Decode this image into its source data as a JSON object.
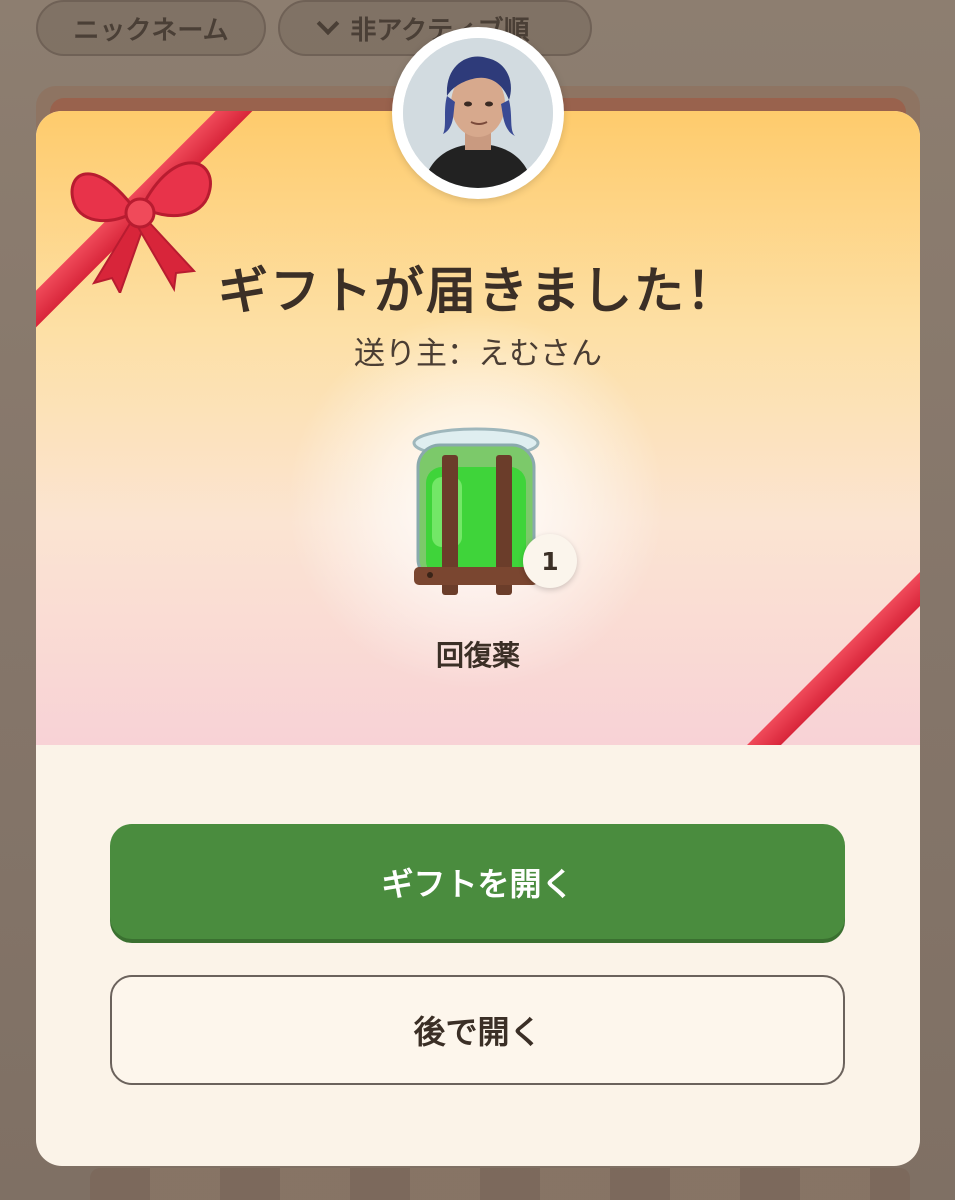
{
  "background": {
    "chips": [
      {
        "label": "ニックネーム"
      },
      {
        "label": "非アクティブ順"
      }
    ]
  },
  "gift_modal": {
    "title": "ギフトが届きました！",
    "sender": "送り主：えむさん",
    "item": {
      "name": "回復薬",
      "count": "1",
      "icon": "potion-jar-icon"
    },
    "buttons": {
      "open": "ギフトを開く",
      "later": "後で開く"
    }
  },
  "colors": {
    "primary_button": "#4a8c3e",
    "ribbon": "#e02f42",
    "header_top": "#fecb6c",
    "header_bottom": "#f8d2d6"
  }
}
